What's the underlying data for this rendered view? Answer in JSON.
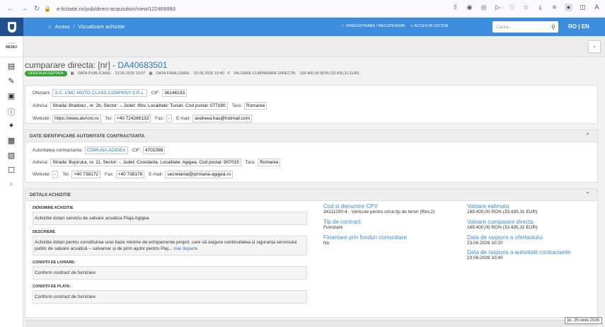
{
  "browser": {
    "url": "e-licitatie.ro/pub/direct-acquisition/view/122469993",
    "icons": [
      "back-icon",
      "forward-icon",
      "reload-icon",
      "lock-icon",
      "share-icon",
      "camera-icon",
      "extension-icon",
      "play-icon",
      "bookmark-icon",
      "favorites-icon",
      "download-icon",
      "menu-icon",
      "profile-icon",
      "puzzle-icon",
      "reader-icon"
    ]
  },
  "header": {
    "home": "Acasa",
    "breadcrumb_sep": "/",
    "current": "Vizualizare achizitie",
    "register": "INREGISTRARE / RECUPERARE",
    "login": "ACCES IN SISTEM",
    "search_placeholder": "Cauta...",
    "lang_ro": "RO",
    "lang_sep": "|",
    "lang_en": "EN"
  },
  "sidebar": {
    "small_text": "e-licitatie",
    "menu_label": "MENIU"
  },
  "page": {
    "title_prefix": "cumparare directa: [nr] - ",
    "code": "DA40683501",
    "badge": "OFERTA ACCEPTATA",
    "publish_label": "DATA PUBLICARE:",
    "publish_value": "23.06.2026 10:07",
    "final_label": "DATA FINALIZARE:",
    "final_value": "23.06.2026 10:40",
    "value_label": "VALOARE CUMPARARE DIRECTA:",
    "value_value": "169.400,00 RON (33.435,31 EUR)"
  },
  "ofertant": {
    "ofertant_label": "Ofertant:",
    "ofertant_value": "S.C. CMC MOTO CLASS COMPANY S.R.L.",
    "cif_label": "CIF:",
    "cif_value": "36146193",
    "address_label": "Adresa:",
    "address_value": "Strada: Bradului , nr. 2b, Sector: -, Judet: Ilfov, Localitate: Tunari, Cod postal: 077180",
    "country_label": "Tara:",
    "country_value": "Romania",
    "website_label": "Website:",
    "website_value": "https://www.atvrom.ro",
    "tel_label": "Tel:",
    "tel_value": "+40 724266133",
    "fax_label": "Fax:",
    "fax_value": "-",
    "email_label": "E-mail:",
    "email_value": "andreea.has@hotmail.com"
  },
  "autoritate": {
    "heading": "DATE IDENTIFICARE AUTORITATE CONTRACTANTA",
    "auth_label": "Autoritatea contractanta:",
    "auth_value": "COMUNA AGIGEA",
    "cif_label": "CIF:",
    "cif_value": "4701088",
    "address_label": "Adresa:",
    "address_value": "Strada: Bujorului, nr. 11, Sector: -, Judet: Constanta, Localitate: Agigea, Cod postal: 907015",
    "country_label": "Tara:",
    "country_value": "Romania",
    "website_label": "Website:",
    "website_value": "-",
    "tel_label": "Tel:",
    "tel_value": "+40 738172",
    "fax_label": "Fax:",
    "fax_value": "+40 738178",
    "email_label": "E-mail:",
    "email_value": "secretariat@primaria-agigea.ro"
  },
  "detalii": {
    "heading": "DETALII ACHIZITIE",
    "denumire_label": "DENUMIRE ACHIZITIE",
    "denumire_value": "Achizitie dotari serviciu de salvare acvatica Plaja Agigea",
    "descriere_label": "DESCRIERE",
    "descriere_value": "Achiziție dotari pentru constituirea unei baze minime de echipamente proprii, care să asigure continuitatea și siguranța serviciului public de salvare acvatică – salvamar și de prim ajutor pentru Plaj...",
    "descriere_more": "mai departe",
    "livrare_label": "CONDITII DE LIVRARE:",
    "livrare_value": "Conform contract de furnizare",
    "plata_label": "CONDITII DE PLATA:",
    "plata_value": "Conform contract de furnizare",
    "cpv_label": "Cod si denumire CPV",
    "cpv_value": "34111200-4 - Vehicule pentru orice tip de teren (Rev.2)",
    "tip_label": "Tip de contract",
    "tip_value": "Furnizare",
    "finantare_label": "Finantare prin fonduri comunitare",
    "finantare_value": "Nu",
    "val_est_label": "Valoare estimata",
    "val_est_value": "169.400,00 RON (33.435,31 EUR)",
    "val_cump_label": "Valoare cumparare directa",
    "val_cump_value": "169.400,00 RON (33.435,31 EUR)",
    "raspuns_ofertant_label": "Data de raspuns a ofertantului",
    "raspuns_ofertant_value": "23.06.2026 10:20",
    "raspuns_autoritate_label": "Data de raspuns a autoritatii contractante",
    "raspuns_autoritate_value": "23.06.2026 10:40"
  },
  "date_tooltip": "joi, 25 iunie 2026"
}
